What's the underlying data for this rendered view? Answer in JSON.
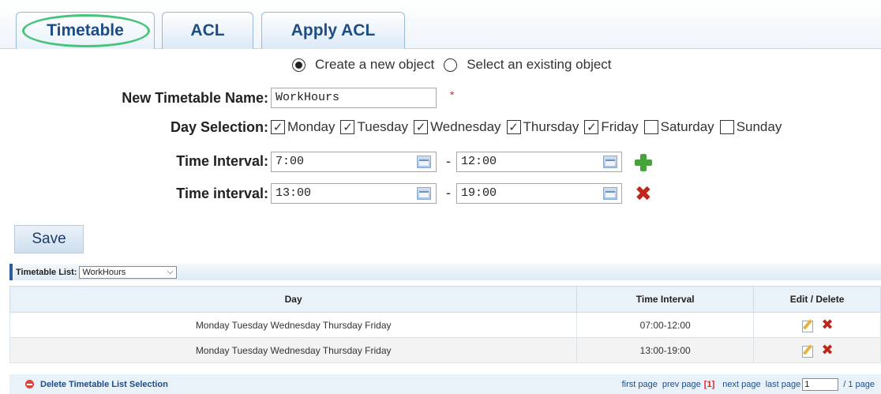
{
  "tabs": [
    {
      "label": "Timetable",
      "active": true
    },
    {
      "label": "ACL"
    },
    {
      "label": "Apply ACL"
    }
  ],
  "mode": {
    "options": [
      "Create a new object",
      "Select an existing object"
    ],
    "selected": "Create a new object"
  },
  "form": {
    "name_label": "New Timetable Name:",
    "name_value": "WorkHours",
    "required_mark": "*",
    "days_label": "Day Selection:",
    "days": [
      {
        "label": "Monday",
        "checked": true
      },
      {
        "label": "Tuesday",
        "checked": true
      },
      {
        "label": "Wednesday",
        "checked": true
      },
      {
        "label": "Thursday",
        "checked": true
      },
      {
        "label": "Friday",
        "checked": true
      },
      {
        "label": "Saturday",
        "checked": false
      },
      {
        "label": "Sunday",
        "checked": false
      }
    ],
    "intervals": [
      {
        "label": "Time Interval:",
        "start": "7:00",
        "end": "12:00",
        "action_icon": "add-icon"
      },
      {
        "label": "Time interval:",
        "start": "13:00",
        "end": "19:00",
        "action_icon": "remove-icon"
      }
    ],
    "separator": "-",
    "save_label": "Save"
  },
  "list": {
    "title": "Timetable List:",
    "selected": "WorkHours",
    "columns": [
      "Day",
      "Time Interval",
      "Edit / Delete"
    ],
    "rows": [
      {
        "day": "Monday Tuesday Wednesday Thursday Friday",
        "interval": "07:00-12:00"
      },
      {
        "day": "Monday Tuesday Wednesday Thursday Friday",
        "interval": "13:00-19:00"
      }
    ],
    "delete_selection_label": "Delete Timetable List Selection",
    "pager": {
      "first": "first page",
      "prev": "prev page",
      "current": "[1]",
      "next": "next page",
      "last": "last page",
      "page_value": "1",
      "total": "/ 1 page"
    }
  },
  "colors": {
    "tab_text": "#1e4d86",
    "required": "#dd2222",
    "add_icon": "#46a33a",
    "remove_icon": "#c0261b",
    "tab_highlight": "#48c47a"
  }
}
